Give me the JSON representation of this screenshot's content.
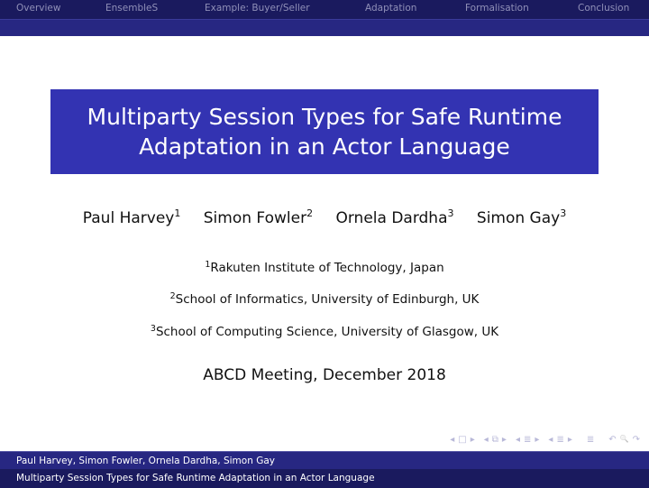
{
  "nav": {
    "sections": [
      "Overview",
      "EnsembleS",
      "Example: Buyer/Seller",
      "Adaptation",
      "Formalisation",
      "Conclusion"
    ]
  },
  "title": {
    "line1": "Multiparty Session Types for Safe Runtime",
    "line2": "Adaptation in an Actor Language"
  },
  "authors": [
    {
      "name": "Paul Harvey",
      "affil": "1"
    },
    {
      "name": "Simon Fowler",
      "affil": "2"
    },
    {
      "name": "Ornela Dardha",
      "affil": "3"
    },
    {
      "name": "Simon Gay",
      "affil": "3"
    }
  ],
  "affiliations": [
    {
      "num": "1",
      "text": "Rakuten Institute of Technology, Japan"
    },
    {
      "num": "2",
      "text": "School of Informatics, University of Edinburgh, UK"
    },
    {
      "num": "3",
      "text": "School of Computing Science, University of Glasgow, UK"
    }
  ],
  "event": "ABCD Meeting, December 2018",
  "beamer_nav": {
    "icons": [
      "frame-prev-icon",
      "frame-icon",
      "frame-next-icon",
      "subsection-prev-icon",
      "subsection-icon",
      "subsection-next-icon",
      "section-prev-icon",
      "section-icon",
      "section-next-icon",
      "sub-prev-icon",
      "subsubsection-icon",
      "sub-next-icon",
      "align-icon",
      "back-icon",
      "search-icon",
      "forward-icon"
    ],
    "glyphs": [
      "◂",
      "□",
      "▸",
      "◂",
      "⧉",
      "▸",
      "◂",
      "≣",
      "▸",
      "◂",
      "≣",
      "▸",
      "≣",
      "↶",
      "🔍",
      "↷"
    ]
  },
  "footer": {
    "authors": "Paul Harvey, Simon Fowler, Ornela Dardha, Simon Gay",
    "title": "Multiparty Session Types for Safe Runtime Adaptation in an Actor Language"
  },
  "colors": {
    "nav_bg": "#1a1a5e",
    "subbar_bg": "#272782",
    "title_bg": "#3333b2",
    "nav_text": "#9090b8"
  }
}
